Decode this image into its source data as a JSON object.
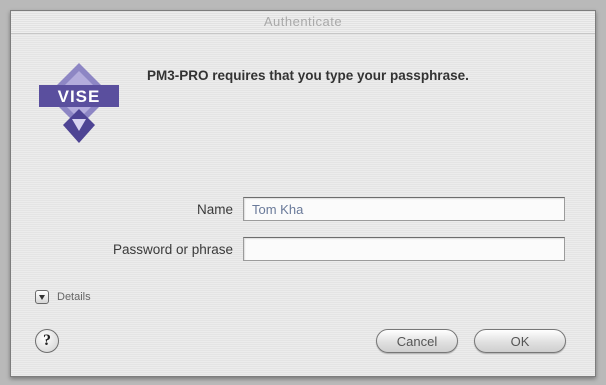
{
  "window": {
    "title": "Authenticate"
  },
  "logo": {
    "text": "VISE",
    "icon": "vise-installer-logo"
  },
  "message": "PM3-PRO requires that you type your passphrase.",
  "fields": {
    "name_label": "Name",
    "name_value": "Tom Kha",
    "password_label": "Password or phrase",
    "password_value": ""
  },
  "details": {
    "label": "Details",
    "icon": "disclosure-triangle-icon"
  },
  "buttons": {
    "help_label": "?",
    "cancel_label": "Cancel",
    "ok_label": "OK"
  },
  "colors": {
    "logo_purple": "#5a4f9e",
    "logo_light": "#a9a2d4"
  }
}
